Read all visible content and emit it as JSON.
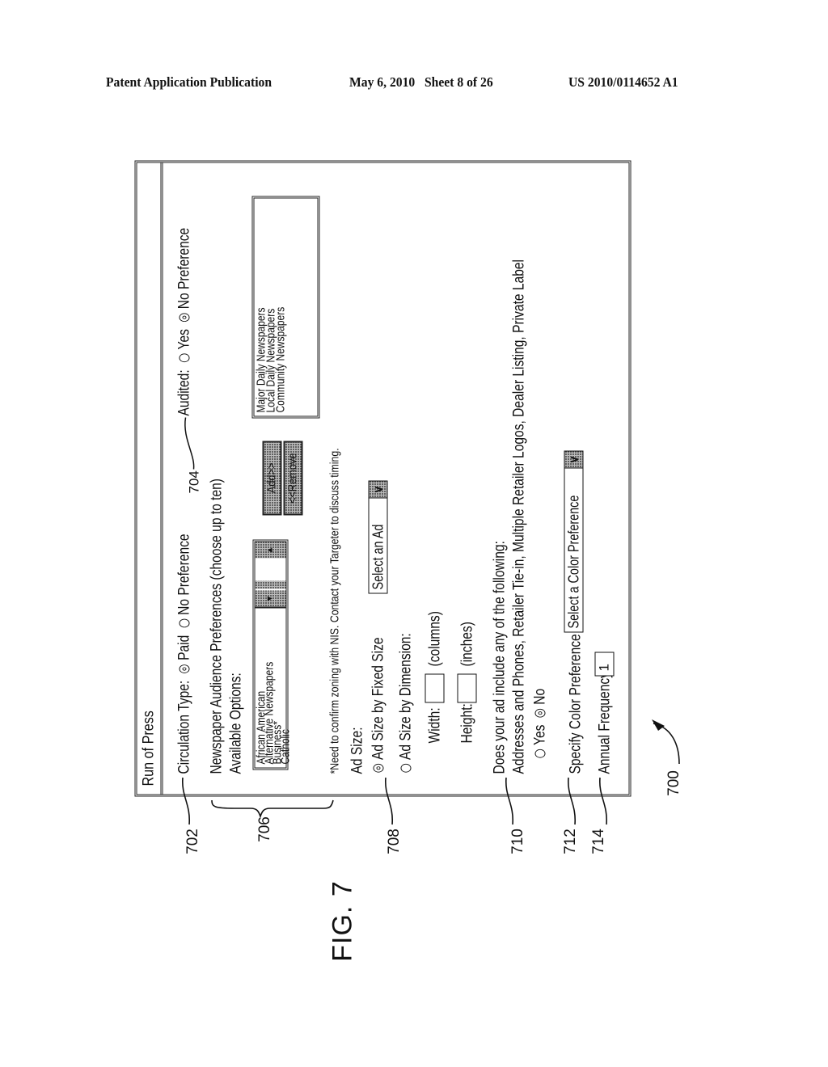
{
  "header": {
    "publication": "Patent Application Publication",
    "date_sheet": "May 6, 2010   Sheet 8 of 26",
    "number": "US 2010/0114652 A1"
  },
  "figure": {
    "label": "FIG. 7",
    "reference": "700"
  },
  "form": {
    "title": "Run of Press",
    "circulation": {
      "label": "Circulation Type:",
      "options": [
        {
          "label": "Paid",
          "selected": true
        },
        {
          "label": "No Preference",
          "selected": false
        }
      ]
    },
    "audited": {
      "label": "Audited:",
      "options": [
        {
          "label": "Yes",
          "selected": false
        },
        {
          "label": "No Preference",
          "selected": true
        }
      ]
    },
    "audience": {
      "heading": "Newspaper Audience Preferences  (choose up to ten)",
      "available_label": "Available Options:",
      "available": [
        "African American",
        "Alternative Newspapers",
        "Business*",
        "Catholic"
      ],
      "add_button": "Add>>",
      "remove_button": "<<Remove",
      "selected": [
        "Major Daily Newspapers",
        "Local Daily Newspapers",
        "Community Newspapers"
      ],
      "note": "*Need to confirm zoning with NIS. Contact your Targeter to discuss timing."
    },
    "ad_size": {
      "label": "Ad Size:",
      "fixed_label": "Ad Size by Fixed Size",
      "fixed_selected": true,
      "fixed_select_value": "Select an Ad",
      "dimension_label": "Ad Size by Dimension:",
      "dimension_selected": false,
      "width_label": "Width:",
      "width_value": "",
      "width_unit": "(columns)",
      "height_label": "Height:",
      "height_value": "",
      "height_unit": "(inches)"
    },
    "includes": {
      "question": "Does your ad include any of the following:",
      "list": "Addresses and Phones, Retailer Tie-in, Multiple Retailer Logos, Dealer Listing, Private Label",
      "options": [
        {
          "label": "Yes",
          "selected": false
        },
        {
          "label": "No",
          "selected": true
        }
      ]
    },
    "color": {
      "label": "Specify Color Preference",
      "select_value": "Select a Color Preference"
    },
    "frequency": {
      "label": "Annual Frequency",
      "value": "1"
    }
  },
  "callouts": {
    "c702": "702",
    "c704": "704",
    "c706": "706",
    "c708": "708",
    "c710": "710",
    "c712": "712",
    "c714": "714"
  }
}
